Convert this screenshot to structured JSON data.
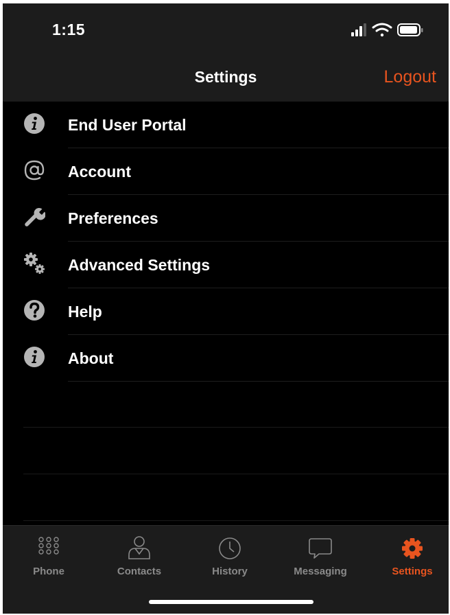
{
  "status_bar": {
    "time": "1:15",
    "icons": [
      "signal-icon",
      "wifi-icon",
      "battery-icon"
    ]
  },
  "nav": {
    "title": "Settings",
    "logout_label": "Logout"
  },
  "menu": {
    "items": [
      {
        "label": "End User Portal",
        "icon": "info-icon"
      },
      {
        "label": "Account",
        "icon": "at-sign-icon"
      },
      {
        "label": "Preferences",
        "icon": "wrench-icon"
      },
      {
        "label": "Advanced Settings",
        "icon": "gears-icon"
      },
      {
        "label": "Help",
        "icon": "help-icon"
      },
      {
        "label": "About",
        "icon": "info-icon"
      }
    ]
  },
  "tabs": [
    {
      "label": "Phone",
      "icon": "keypad-icon",
      "active": false
    },
    {
      "label": "Contacts",
      "icon": "contact-icon",
      "active": false
    },
    {
      "label": "History",
      "icon": "clock-icon",
      "active": false
    },
    {
      "label": "Messaging",
      "icon": "chat-bubble-icon",
      "active": false
    },
    {
      "label": "Settings",
      "icon": "gear-icon",
      "active": true
    }
  ],
  "colors": {
    "accent": "#e8541f",
    "background": "#000000",
    "header": "#1c1c1c",
    "icon_gray": "#b5b5b5",
    "tab_inactive": "#8a8a8a"
  }
}
